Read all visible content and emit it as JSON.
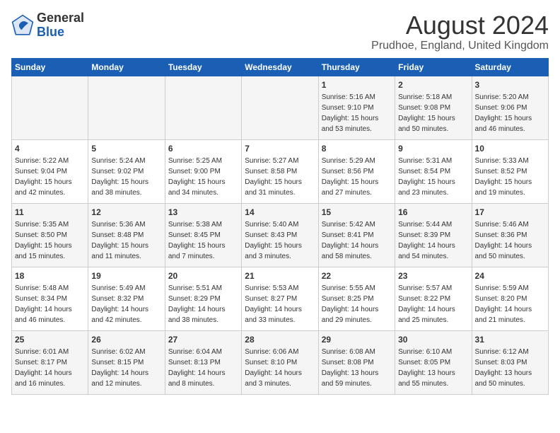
{
  "header": {
    "logo_line1": "General",
    "logo_line2": "Blue",
    "main_title": "August 2024",
    "subtitle": "Prudhoe, England, United Kingdom"
  },
  "weekdays": [
    "Sunday",
    "Monday",
    "Tuesday",
    "Wednesday",
    "Thursday",
    "Friday",
    "Saturday"
  ],
  "weeks": [
    [
      {
        "day": "",
        "sunrise": "",
        "sunset": "",
        "daylight": ""
      },
      {
        "day": "",
        "sunrise": "",
        "sunset": "",
        "daylight": ""
      },
      {
        "day": "",
        "sunrise": "",
        "sunset": "",
        "daylight": ""
      },
      {
        "day": "",
        "sunrise": "",
        "sunset": "",
        "daylight": ""
      },
      {
        "day": "1",
        "sunrise": "Sunrise: 5:16 AM",
        "sunset": "Sunset: 9:10 PM",
        "daylight": "Daylight: 15 hours and 53 minutes."
      },
      {
        "day": "2",
        "sunrise": "Sunrise: 5:18 AM",
        "sunset": "Sunset: 9:08 PM",
        "daylight": "Daylight: 15 hours and 50 minutes."
      },
      {
        "day": "3",
        "sunrise": "Sunrise: 5:20 AM",
        "sunset": "Sunset: 9:06 PM",
        "daylight": "Daylight: 15 hours and 46 minutes."
      }
    ],
    [
      {
        "day": "4",
        "sunrise": "Sunrise: 5:22 AM",
        "sunset": "Sunset: 9:04 PM",
        "daylight": "Daylight: 15 hours and 42 minutes."
      },
      {
        "day": "5",
        "sunrise": "Sunrise: 5:24 AM",
        "sunset": "Sunset: 9:02 PM",
        "daylight": "Daylight: 15 hours and 38 minutes."
      },
      {
        "day": "6",
        "sunrise": "Sunrise: 5:25 AM",
        "sunset": "Sunset: 9:00 PM",
        "daylight": "Daylight: 15 hours and 34 minutes."
      },
      {
        "day": "7",
        "sunrise": "Sunrise: 5:27 AM",
        "sunset": "Sunset: 8:58 PM",
        "daylight": "Daylight: 15 hours and 31 minutes."
      },
      {
        "day": "8",
        "sunrise": "Sunrise: 5:29 AM",
        "sunset": "Sunset: 8:56 PM",
        "daylight": "Daylight: 15 hours and 27 minutes."
      },
      {
        "day": "9",
        "sunrise": "Sunrise: 5:31 AM",
        "sunset": "Sunset: 8:54 PM",
        "daylight": "Daylight: 15 hours and 23 minutes."
      },
      {
        "day": "10",
        "sunrise": "Sunrise: 5:33 AM",
        "sunset": "Sunset: 8:52 PM",
        "daylight": "Daylight: 15 hours and 19 minutes."
      }
    ],
    [
      {
        "day": "11",
        "sunrise": "Sunrise: 5:35 AM",
        "sunset": "Sunset: 8:50 PM",
        "daylight": "Daylight: 15 hours and 15 minutes."
      },
      {
        "day": "12",
        "sunrise": "Sunrise: 5:36 AM",
        "sunset": "Sunset: 8:48 PM",
        "daylight": "Daylight: 15 hours and 11 minutes."
      },
      {
        "day": "13",
        "sunrise": "Sunrise: 5:38 AM",
        "sunset": "Sunset: 8:45 PM",
        "daylight": "Daylight: 15 hours and 7 minutes."
      },
      {
        "day": "14",
        "sunrise": "Sunrise: 5:40 AM",
        "sunset": "Sunset: 8:43 PM",
        "daylight": "Daylight: 15 hours and 3 minutes."
      },
      {
        "day": "15",
        "sunrise": "Sunrise: 5:42 AM",
        "sunset": "Sunset: 8:41 PM",
        "daylight": "Daylight: 14 hours and 58 minutes."
      },
      {
        "day": "16",
        "sunrise": "Sunrise: 5:44 AM",
        "sunset": "Sunset: 8:39 PM",
        "daylight": "Daylight: 14 hours and 54 minutes."
      },
      {
        "day": "17",
        "sunrise": "Sunrise: 5:46 AM",
        "sunset": "Sunset: 8:36 PM",
        "daylight": "Daylight: 14 hours and 50 minutes."
      }
    ],
    [
      {
        "day": "18",
        "sunrise": "Sunrise: 5:48 AM",
        "sunset": "Sunset: 8:34 PM",
        "daylight": "Daylight: 14 hours and 46 minutes."
      },
      {
        "day": "19",
        "sunrise": "Sunrise: 5:49 AM",
        "sunset": "Sunset: 8:32 PM",
        "daylight": "Daylight: 14 hours and 42 minutes."
      },
      {
        "day": "20",
        "sunrise": "Sunrise: 5:51 AM",
        "sunset": "Sunset: 8:29 PM",
        "daylight": "Daylight: 14 hours and 38 minutes."
      },
      {
        "day": "21",
        "sunrise": "Sunrise: 5:53 AM",
        "sunset": "Sunset: 8:27 PM",
        "daylight": "Daylight: 14 hours and 33 minutes."
      },
      {
        "day": "22",
        "sunrise": "Sunrise: 5:55 AM",
        "sunset": "Sunset: 8:25 PM",
        "daylight": "Daylight: 14 hours and 29 minutes."
      },
      {
        "day": "23",
        "sunrise": "Sunrise: 5:57 AM",
        "sunset": "Sunset: 8:22 PM",
        "daylight": "Daylight: 14 hours and 25 minutes."
      },
      {
        "day": "24",
        "sunrise": "Sunrise: 5:59 AM",
        "sunset": "Sunset: 8:20 PM",
        "daylight": "Daylight: 14 hours and 21 minutes."
      }
    ],
    [
      {
        "day": "25",
        "sunrise": "Sunrise: 6:01 AM",
        "sunset": "Sunset: 8:17 PM",
        "daylight": "Daylight: 14 hours and 16 minutes."
      },
      {
        "day": "26",
        "sunrise": "Sunrise: 6:02 AM",
        "sunset": "Sunset: 8:15 PM",
        "daylight": "Daylight: 14 hours and 12 minutes."
      },
      {
        "day": "27",
        "sunrise": "Sunrise: 6:04 AM",
        "sunset": "Sunset: 8:13 PM",
        "daylight": "Daylight: 14 hours and 8 minutes."
      },
      {
        "day": "28",
        "sunrise": "Sunrise: 6:06 AM",
        "sunset": "Sunset: 8:10 PM",
        "daylight": "Daylight: 14 hours and 3 minutes."
      },
      {
        "day": "29",
        "sunrise": "Sunrise: 6:08 AM",
        "sunset": "Sunset: 8:08 PM",
        "daylight": "Daylight: 13 hours and 59 minutes."
      },
      {
        "day": "30",
        "sunrise": "Sunrise: 6:10 AM",
        "sunset": "Sunset: 8:05 PM",
        "daylight": "Daylight: 13 hours and 55 minutes."
      },
      {
        "day": "31",
        "sunrise": "Sunrise: 6:12 AM",
        "sunset": "Sunset: 8:03 PM",
        "daylight": "Daylight: 13 hours and 50 minutes."
      }
    ]
  ]
}
